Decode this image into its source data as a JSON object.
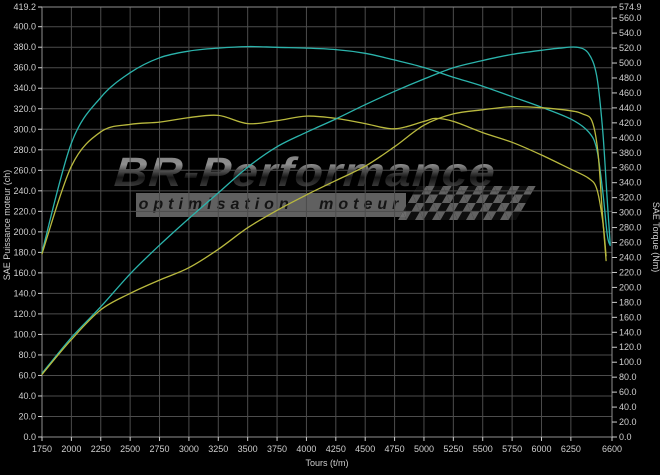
{
  "watermark": {
    "brand": "BR-Performance",
    "tagline": "optimisation moteur"
  },
  "colors": {
    "background": "#000000",
    "grid": "#4c4c4c",
    "frame": "#909090",
    "tick_text": "#cfcfcf",
    "axis_title_text": "#cfcfcf",
    "cyan_curve": "#2bb4ac",
    "yellow_curve": "#b9b93e"
  },
  "chart_data": {
    "type": "line",
    "x_axis": {
      "label": "Tours (t/m)",
      "min": 1750,
      "max": 6600,
      "ticks": [
        1750,
        2000,
        2250,
        2500,
        2750,
        3000,
        3250,
        3500,
        3750,
        4000,
        4250,
        4500,
        4750,
        5000,
        5250,
        5500,
        5750,
        6000,
        6250,
        6600
      ],
      "decimals": 0,
      "grid": true
    },
    "y_left": {
      "label": "SAE Puissance moteur (ch)",
      "min": 0,
      "max": 419.2,
      "ticks": [
        419.2,
        400,
        380,
        360,
        340,
        320,
        300,
        280,
        260,
        240,
        220,
        200,
        180,
        160,
        140,
        120,
        100,
        80,
        60,
        40,
        20,
        0
      ],
      "decimals": 1,
      "grid": true
    },
    "y_right": {
      "label": "SAE Torque (Nm)",
      "min": 0,
      "max": 574.9,
      "ticks": [
        574.9,
        560,
        540,
        520,
        500,
        480,
        460,
        440,
        420,
        400,
        380,
        360,
        340,
        320,
        300,
        280,
        260,
        240,
        220,
        200,
        180,
        160,
        140,
        120,
        100,
        80,
        60,
        40,
        20,
        0
      ],
      "decimals": 1,
      "grid": false
    },
    "legend": "none",
    "series": [
      {
        "name": "cyan-torque",
        "axis": "right",
        "color": "#2bb4ac",
        "points": [
          [
            1750,
            247
          ],
          [
            2000,
            393
          ],
          [
            2250,
            454
          ],
          [
            2500,
            487
          ],
          [
            2750,
            507
          ],
          [
            3000,
            516
          ],
          [
            3250,
            520
          ],
          [
            3500,
            522
          ],
          [
            3750,
            521
          ],
          [
            4000,
            520
          ],
          [
            4250,
            518
          ],
          [
            4500,
            513
          ],
          [
            4750,
            504
          ],
          [
            5000,
            494
          ],
          [
            5250,
            481
          ],
          [
            5500,
            469
          ],
          [
            5750,
            455
          ],
          [
            6000,
            441
          ],
          [
            6250,
            425
          ],
          [
            6400,
            408
          ],
          [
            6470,
            385
          ],
          [
            6520,
            330
          ],
          [
            6560,
            270
          ],
          [
            6585,
            256
          ]
        ]
      },
      {
        "name": "yellow-torque",
        "axis": "right",
        "color": "#b9b93e",
        "points": [
          [
            1750,
            245
          ],
          [
            2000,
            362
          ],
          [
            2250,
            408
          ],
          [
            2500,
            418
          ],
          [
            2750,
            421
          ],
          [
            3000,
            427
          ],
          [
            3250,
            430
          ],
          [
            3500,
            419
          ],
          [
            3750,
            423
          ],
          [
            4000,
            429
          ],
          [
            4250,
            426
          ],
          [
            4500,
            419
          ],
          [
            4750,
            412
          ],
          [
            5000,
            422
          ],
          [
            5100,
            426
          ],
          [
            5250,
            422
          ],
          [
            5500,
            407
          ],
          [
            5750,
            394
          ],
          [
            6000,
            377
          ],
          [
            6250,
            358
          ],
          [
            6400,
            346
          ],
          [
            6470,
            332
          ],
          [
            6520,
            290
          ],
          [
            6550,
            242
          ]
        ]
      },
      {
        "name": "cyan-power",
        "axis": "left",
        "color": "#2bb4ac",
        "points": [
          [
            1750,
            62
          ],
          [
            2000,
            97
          ],
          [
            2250,
            127
          ],
          [
            2500,
            159
          ],
          [
            2750,
            187
          ],
          [
            3000,
            213
          ],
          [
            3250,
            238
          ],
          [
            3500,
            263
          ],
          [
            3750,
            283
          ],
          [
            4000,
            297
          ],
          [
            4250,
            310
          ],
          [
            4500,
            324
          ],
          [
            4750,
            337
          ],
          [
            5000,
            349
          ],
          [
            5250,
            360
          ],
          [
            5500,
            367
          ],
          [
            5750,
            373
          ],
          [
            6000,
            377
          ],
          [
            6150,
            379
          ],
          [
            6300,
            380
          ],
          [
            6400,
            374
          ],
          [
            6470,
            352
          ],
          [
            6520,
            300
          ],
          [
            6560,
            230
          ],
          [
            6585,
            188
          ]
        ]
      },
      {
        "name": "yellow-power",
        "axis": "left",
        "color": "#b9b93e",
        "points": [
          [
            1750,
            61
          ],
          [
            2000,
            95
          ],
          [
            2250,
            124
          ],
          [
            2500,
            140
          ],
          [
            2750,
            153
          ],
          [
            3000,
            165
          ],
          [
            3250,
            183
          ],
          [
            3500,
            204
          ],
          [
            3750,
            221
          ],
          [
            4000,
            236
          ],
          [
            4250,
            250
          ],
          [
            4500,
            264
          ],
          [
            4750,
            283
          ],
          [
            5000,
            304
          ],
          [
            5250,
            315
          ],
          [
            5500,
            319
          ],
          [
            5750,
            322
          ],
          [
            6000,
            321
          ],
          [
            6250,
            318
          ],
          [
            6350,
            315
          ],
          [
            6430,
            308
          ],
          [
            6480,
            278
          ],
          [
            6520,
            215
          ],
          [
            6550,
            172
          ]
        ]
      }
    ]
  }
}
